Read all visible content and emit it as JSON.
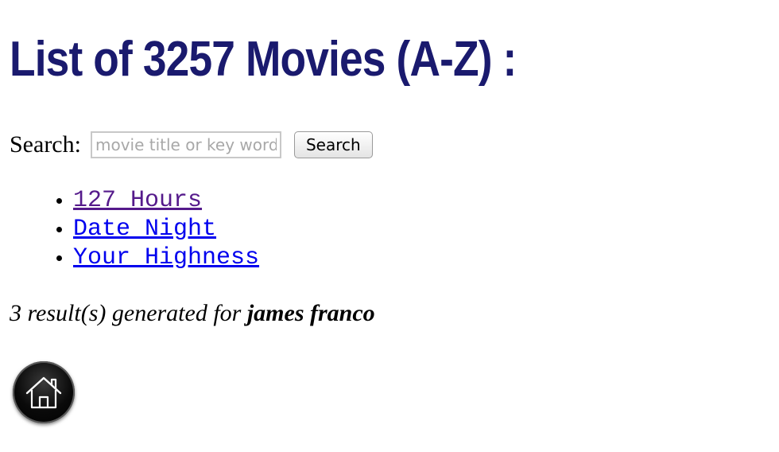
{
  "header": {
    "title": "List of 3257 Movies (A-Z) :"
  },
  "search": {
    "label": "Search:",
    "placeholder": "movie title or key word",
    "value": "",
    "button_label": "Search"
  },
  "results": {
    "items": [
      {
        "label": "127 Hours",
        "visited": true
      },
      {
        "label": "Date Night",
        "visited": false
      },
      {
        "label": "Your Highness",
        "visited": false
      }
    ],
    "summary_prefix": "3 result(s) generated for ",
    "query": "james franco"
  },
  "home": {
    "icon": "home-icon"
  },
  "colors": {
    "title": "#1a1a6e",
    "link": "#0000ee",
    "visited_link": "#551a8b"
  }
}
